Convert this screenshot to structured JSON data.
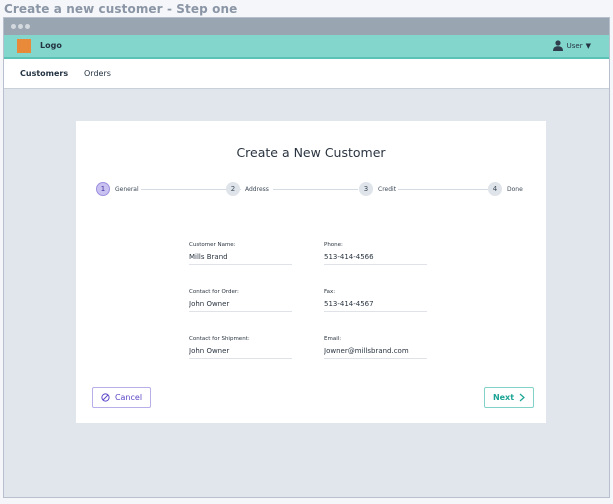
{
  "page_heading": "Create a new customer - Step one",
  "app": {
    "logo_label": "Logo",
    "user_label": "User",
    "user_caret": "▼"
  },
  "nav": {
    "tabs": [
      {
        "label": "Customers",
        "active": true
      },
      {
        "label": "Orders",
        "active": false
      }
    ]
  },
  "form": {
    "title": "Create a New Customer",
    "steps": [
      {
        "number": "1",
        "label": "General",
        "active": true
      },
      {
        "number": "2",
        "label": "Address",
        "active": false
      },
      {
        "number": "3",
        "label": "Credit",
        "active": false
      },
      {
        "number": "4",
        "label": "Done",
        "active": false
      }
    ],
    "fields": {
      "customer_name": {
        "label": "Customer Name:",
        "value": "Mills Brand"
      },
      "phone": {
        "label": "Phone:",
        "value": "513-414-4566"
      },
      "contact_order": {
        "label": "Contact for Order:",
        "value": "John Owner"
      },
      "fax": {
        "label": "Fax:",
        "value": "513-414-4567"
      },
      "contact_shipment": {
        "label": "Contact for Shipment:",
        "value": "John Owner"
      },
      "email": {
        "label": "Email:",
        "value": "Jowner@millsbrand.com"
      }
    },
    "cancel_label": "Cancel",
    "next_label": "Next"
  },
  "colors": {
    "topbar": "#83d6cc",
    "logo": "#e98a3a",
    "cancel": "#5b48c8",
    "next": "#1ba493",
    "active_step": "#c9c1f0"
  }
}
